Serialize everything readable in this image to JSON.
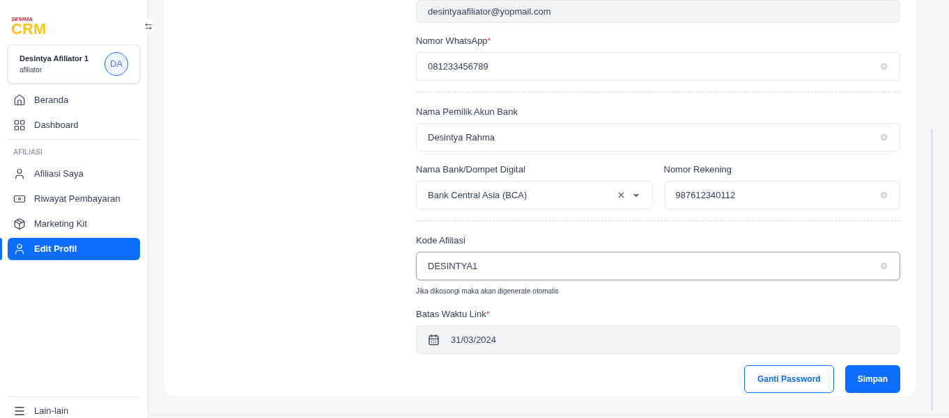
{
  "sidebar": {
    "logo": {
      "top": "SEVIMA",
      "main": "CRM"
    },
    "user": {
      "name": "Desintya Afiliator 1",
      "role": "afiliator",
      "initials": "DA"
    },
    "groups": [
      {
        "items": [
          {
            "label": "Beranda",
            "selected": false
          },
          {
            "label": "Dashboard",
            "selected": false
          }
        ]
      },
      {
        "title": "AFILIASI",
        "items": [
          {
            "label": "Afiliasi Saya",
            "selected": false
          },
          {
            "label": "Riwayat Pembayaran",
            "selected": false
          },
          {
            "label": "Marketing Kit",
            "selected": false
          },
          {
            "label": "Edit Profil",
            "selected": true
          }
        ]
      }
    ],
    "footer_item": {
      "label": "Lain-lain"
    }
  },
  "form": {
    "sections": [
      {
        "rows": [
          [
            {
              "kind": "text",
              "value": "desintyaafiliator@yopmail.com",
              "disabled": true,
              "clearable": false,
              "focused": false
            }
          ],
          [
            {
              "kind": "text",
              "label": "Nomor WhatsApp",
              "required_mark": "*",
              "value": "081233456789",
              "disabled": false,
              "clearable": true,
              "focused": false
            }
          ]
        ]
      },
      {
        "rows": [
          [
            {
              "kind": "text",
              "label": "Nama Pemilik Akun Bank",
              "value": "Desintya Rahma",
              "disabled": false,
              "clearable": true,
              "focused": false
            }
          ],
          [
            {
              "kind": "select",
              "label": "Nama Bank/Dompet Digital",
              "value": "Bank Central Asia (BCA)",
              "disabled": false,
              "clearable": true,
              "focused": false
            },
            {
              "kind": "text",
              "label": "Nomor Rekening",
              "value": "987612340112",
              "disabled": false,
              "clearable": true,
              "focused": false
            }
          ]
        ]
      },
      {
        "rows": [
          [
            {
              "kind": "text",
              "label": "Kode Afiliasi",
              "value": "DESINTYA1",
              "disabled": false,
              "clearable": true,
              "focused": true,
              "hint": "Jika dikosongi maka akan digenerate otomatis"
            }
          ],
          [
            {
              "kind": "date",
              "label": "Batas Waktu Link",
              "required_mark": "*",
              "value": "31/03/2024",
              "disabled": true,
              "clearable": false,
              "focused": false
            }
          ]
        ]
      }
    ],
    "buttons": [
      {
        "label": "Ganti Password",
        "kind": "outline"
      },
      {
        "label": "Simpan",
        "kind": "primary"
      }
    ]
  }
}
